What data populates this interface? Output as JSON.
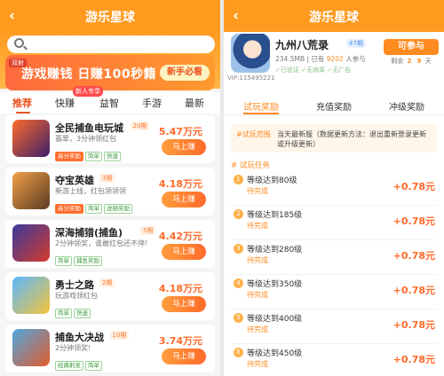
{
  "left": {
    "title": "游乐星球",
    "back": "‹",
    "banner": {
      "tag": "双射",
      "text": "游戏赚钱 日赚100秒籍",
      "cta": "新手必看"
    },
    "new_tag": "新人专享",
    "tabs": [
      "推荐",
      "快赚",
      "益智",
      "手游",
      "最新"
    ],
    "games": [
      {
        "name": "全民捕鱼电玩城",
        "period": "20期",
        "desc": "翡翠，3分钟领红包",
        "chips": [
          "高分奖励",
          "简单",
          "快速"
        ],
        "reward": "5.47万元",
        "button": "马上赚",
        "colors": [
          "#ff6b2a",
          "#3b1f6b"
        ]
      },
      {
        "name": "夺宝英雄",
        "period": "3期",
        "desc": "新游上线，红包领领领",
        "chips": [
          "高分奖励",
          "简单",
          "送额奖励"
        ],
        "reward": "4.18万元",
        "button": "马上赚",
        "colors": [
          "#f2a14a",
          "#5a3b22"
        ]
      },
      {
        "name": "深海捕猎(捕鱼)",
        "period": "5期",
        "desc": "2分钟领奖，谁敢红包还不停!",
        "chips": [
          "简单",
          "捕鱼奖励"
        ],
        "reward": "4.42万元",
        "button": "马上赚",
        "colors": [
          "#3a3a9e",
          "#d43a2a"
        ]
      },
      {
        "name": "勇士之路",
        "period": "2期",
        "desc": "玩游戏领红包",
        "chips": [
          "简单",
          "快速"
        ],
        "reward": "4.18万元",
        "button": "马上赚",
        "colors": [
          "#5ab8ff",
          "#f5c43a"
        ]
      },
      {
        "name": "捕鱼大决战",
        "period": "10期",
        "desc": "2分钟领奖!",
        "chips": [
          "经典射发",
          "简单"
        ],
        "reward": "3.74万元",
        "button": "马上赚",
        "colors": [
          "#4fa8e0",
          "#e25a2a"
        ]
      }
    ]
  },
  "right": {
    "title": "游乐星球",
    "back": "‹",
    "app": {
      "name": "九州八荒录",
      "period": "47期",
      "vip": "VIP:115495221",
      "size": "234.5MB",
      "participants_prefix": "已有",
      "participants": "9202",
      "participants_suffix": "人参与",
      "badges": [
        "已验证",
        "无病毒",
        "无广告"
      ]
    },
    "participate": "可参与",
    "remain": {
      "label": "剩余",
      "days": "2",
      "hours": "9",
      "unit": "天"
    },
    "tabs": [
      "试玩奖励",
      "充值奖励",
      "冲级奖励"
    ],
    "scope": {
      "label": "#试玩范围",
      "text": "当天最新服（数据更新方法：退出重新登录更新或升级更新）"
    },
    "section": "# 试玩任务",
    "tasks": [
      {
        "num": "1",
        "name": "等级达到80级",
        "status": "待完成",
        "amount": "+0.78元"
      },
      {
        "num": "2",
        "name": "等级达到185级",
        "status": "待完成",
        "amount": "+0.78元"
      },
      {
        "num": "3",
        "name": "等级达到280级",
        "status": "待完成",
        "amount": "+0.78元"
      },
      {
        "num": "4",
        "name": "等级达到350级",
        "status": "待完成",
        "amount": "+0.78元"
      },
      {
        "num": "5",
        "name": "等级达到400级",
        "status": "待完成",
        "amount": "+0.78元"
      },
      {
        "num": "6",
        "name": "等级达到450级",
        "status": "待完成",
        "amount": "+0.78元"
      }
    ]
  },
  "colors": {
    "accent": "#ff8a1f",
    "reward": "#ff6a2a"
  }
}
